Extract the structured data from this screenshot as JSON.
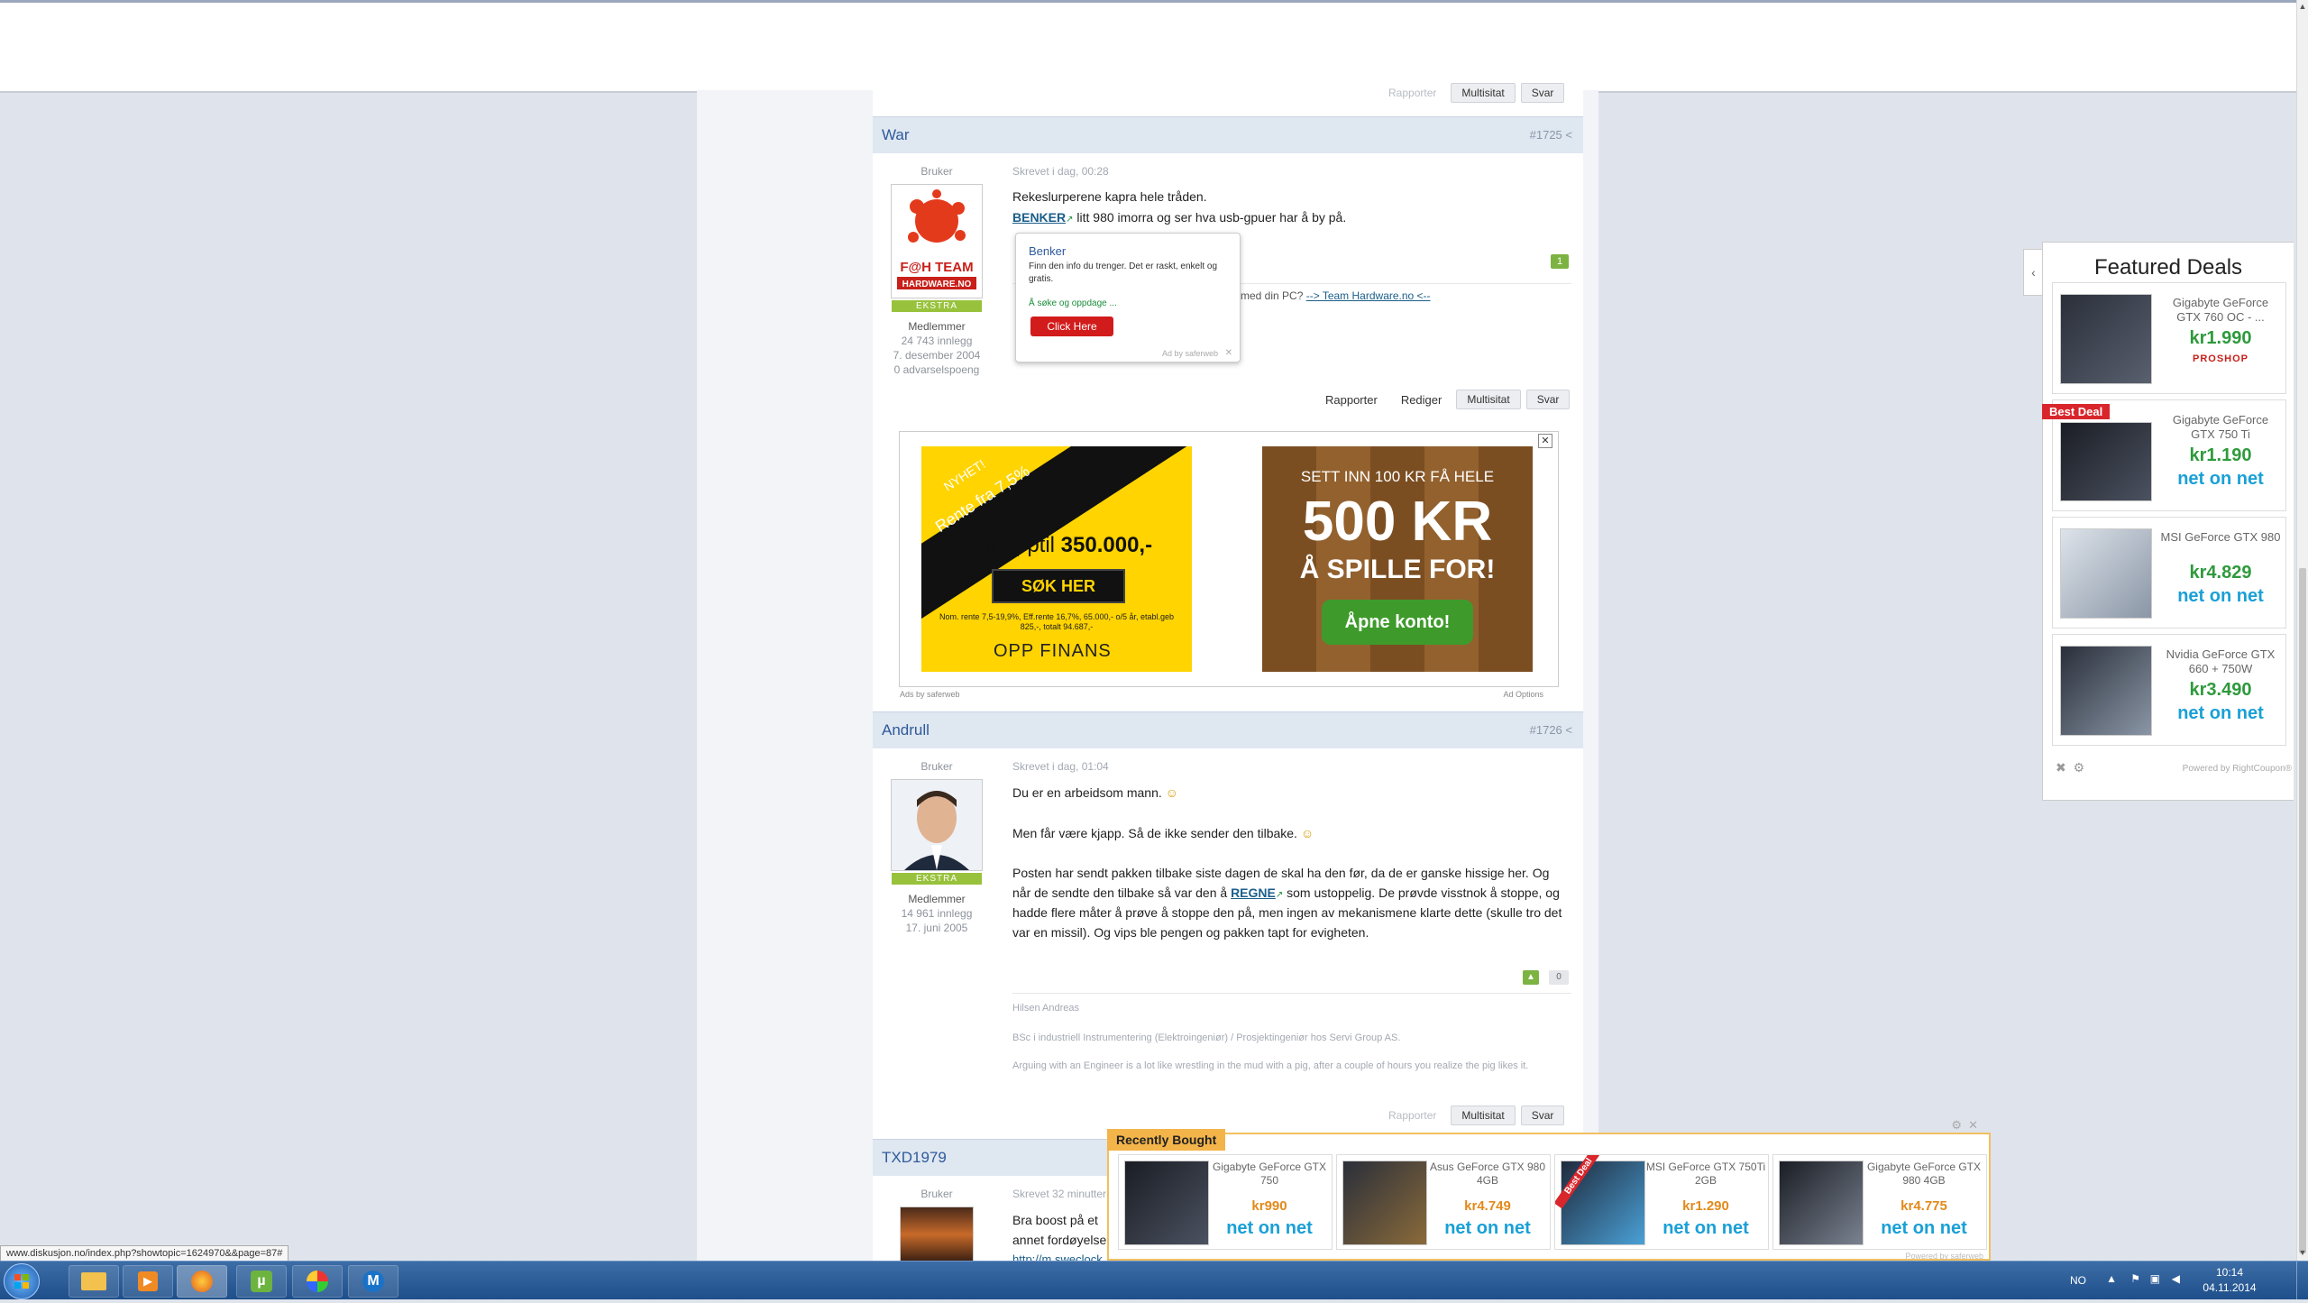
{
  "status_url": "www.diskusjon.no/index.php?showtopic=1624970&&page=87#",
  "buttons": {
    "report": "Rapporter",
    "edit": "Rediger",
    "multiquote": "Multisitat",
    "reply": "Svar"
  },
  "posts": [
    {
      "author": "War",
      "number": "#1725",
      "role": "Bruker",
      "written": "Skrevet i dag, 00:28",
      "rank": "EKSTRA",
      "group": "Medlemmer",
      "posts_count": "24 743 innlegg",
      "joined": "7. desember 2004",
      "warnings": "0 advarselspoeng",
      "line1": "Rekeslurperene kapra hele tråden.",
      "line2_link": "BENKER",
      "line2_rest": "litt 980 imorra og ser hva usb-gpuer har å by på.",
      "sig_fragment": "med din PC?",
      "sig_link": "--> Team Hardware.no <--",
      "like_count": "1"
    },
    {
      "author": "Andrull",
      "number": "#1726",
      "role": "Bruker",
      "written": "Skrevet i dag, 01:04",
      "rank": "EKSTRA",
      "group": "Medlemmer",
      "posts_count": "14 961 innlegg",
      "joined": "17. juni 2005",
      "p1": "Du er en arbeidsom mann.",
      "p2": "Men får være kjapp. Så de ikke sender den tilbake.",
      "p3a": "Posten har sendt pakken tilbake siste dagen de skal ha den før, da de er ganske hissige her. Og",
      "p3b_pre": "når de sendte den tilbake så var den å",
      "p3b_link": "REGNE",
      "p3b_post": "som ustoppelig. De prøvde visstnok å stoppe, og",
      "p3c": "hadde flere måter å prøve å stoppe den på, men ingen av mekanismene klarte dette (skulle tro det",
      "p3d": "var en missil). Og vips ble pengen og pakken tapt for evigheten.",
      "vote_count": "0",
      "sig1": "Hilsen Andreas",
      "sig2": "BSc i industriell Instrumentering (Elektroingeniør) / Prosjektingeniør hos Servi Group AS.",
      "sig3": "Arguing with an Engineer is a lot like wrestling in the mud with a pig, after a couple of hours you realize the pig likes it."
    },
    {
      "author": "TXD1979",
      "role": "Bruker",
      "written": "Skrevet 32 minutter",
      "line1": "Bra boost på et",
      "line2": "annet fordøyelse",
      "line3": "http://m.sweclock"
    }
  ],
  "popup_ad": {
    "title": "Benker",
    "text": "Finn den info du trenger. Det er raskt, enkelt og gratis.",
    "sub": "Å søke og oppdage ...",
    "cta": "Click Here",
    "footer": "Ad by saferweb"
  },
  "ad_block": {
    "left_label": "Ads by saferweb",
    "right_label": "Ad Options",
    "bank": {
      "badge": "NYHET!",
      "rate": "Rente fra 7,5%",
      "loan_pre": "Lån opptil",
      "loan_amount": "350.000,-",
      "cta": "SØK HER",
      "fine": "Nom. rente 7,5-19,9%, Eff.rente 16,7%, 65.000,- o/5 år, etabl.geb 825,-, totalt 94.687,-",
      "brand": "OPP FINANS"
    },
    "casino": {
      "line1": "SETT INN 100 KR FÅ HELE",
      "line2": "500 KR",
      "line3": "Å SPILLE FOR!",
      "cta": "Åpne konto!"
    }
  },
  "featured_deals": {
    "title": "Featured Deals",
    "items": [
      {
        "name": "Gigabyte GeForce GTX 760 OC - ...",
        "price": "kr1.990",
        "shop": "PROSHOP",
        "badge": ""
      },
      {
        "name": "Gigabyte GeForce GTX 750 Ti",
        "price": "kr1.190",
        "shop": "net on net",
        "badge": "Best Deal"
      },
      {
        "name": "MSI GeForce GTX 980",
        "price": "kr4.829",
        "shop": "net on net",
        "badge": ""
      },
      {
        "name": "Nvidia GeForce GTX 660 + 750W",
        "price": "kr3.490",
        "shop": "net on net",
        "badge": ""
      }
    ],
    "powered": "Powered by RightCoupon®"
  },
  "recently_bought": {
    "label": "Recently Bought",
    "items": [
      {
        "name": "Gigabyte GeForce GTX 750",
        "price": "kr990",
        "shop": "net on net"
      },
      {
        "name": "Asus GeForce GTX 980 4GB",
        "price": "kr4.749",
        "shop": "net on net"
      },
      {
        "name": "MSI GeForce GTX 750Ti 2GB",
        "price": "kr1.290",
        "shop": "net on net",
        "badge": "Best Deal"
      },
      {
        "name": "Gigabyte GeForce GTX 980 4GB",
        "price": "kr4.775",
        "shop": "net on net"
      }
    ],
    "powered": "Powered by saferweb"
  },
  "taskbar": {
    "lang": "NO",
    "time": "10:14",
    "date": "04.11.2014"
  },
  "colors": {
    "accent": "#2f5a9a",
    "price_green": "#2e9a3c",
    "netonnet_blue": "#1aa0d6",
    "rank_green": "#98c23c",
    "bank_yellow": "#ffd400"
  }
}
